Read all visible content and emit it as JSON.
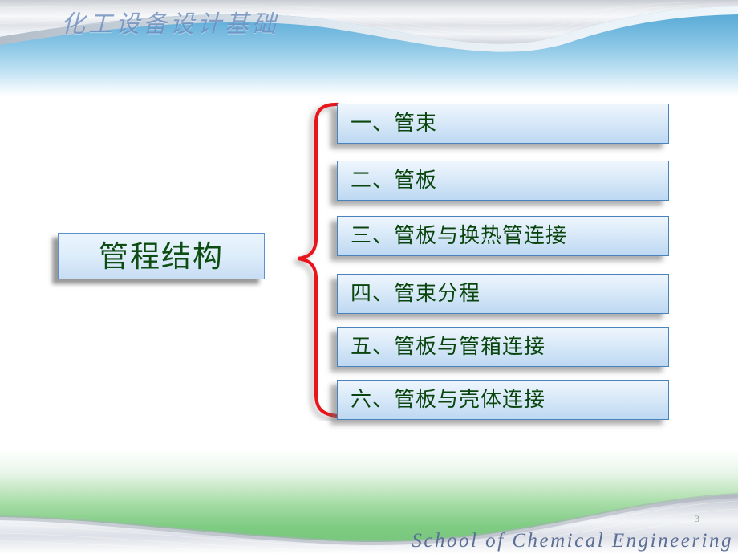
{
  "header": {
    "course_title": "化工设备设计基础"
  },
  "main": {
    "title_box": {
      "label": "管程结构"
    },
    "items": [
      {
        "label": "一、管束"
      },
      {
        "label": "二、管板"
      },
      {
        "label": "三、管板与换热管连接"
      },
      {
        "label": "四、管束分程"
      },
      {
        "label": "五、管板与管箱连接"
      },
      {
        "label": "六、管板与壳体连接"
      }
    ]
  },
  "footer": {
    "organization": "School of Chemical Engineering",
    "page_number": "3"
  },
  "colors": {
    "banner_blue": "#4b9ed0",
    "footer_green": "#74c47a",
    "box_border": "#4a82bd",
    "box_fill_top": "#eef6fd",
    "box_fill_bottom": "#bdd8f2",
    "text_green": "#0b450e",
    "brace_red": "#e8151b",
    "footer_text": "#5b6f96",
    "header_text": "#6f8fc0"
  }
}
